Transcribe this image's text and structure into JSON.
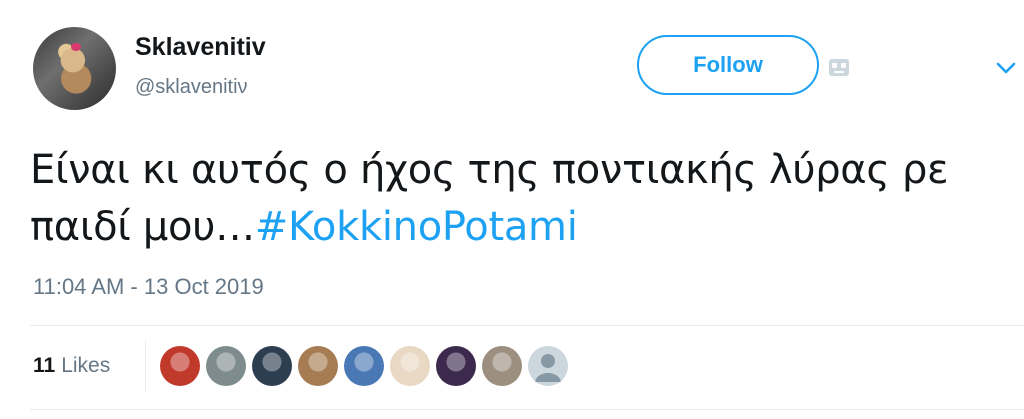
{
  "user": {
    "name": "Sklavenitiv",
    "handle": "@sklavenitiν",
    "avatar_icon": "user-avatar-dog-photo"
  },
  "follow": {
    "label": "Follow",
    "color": "#1da1f2"
  },
  "icons": {
    "bot": "bot-icon",
    "more": "chevron-down-icon"
  },
  "tweet": {
    "text": "Είναι κι αυτός ο ήχος της ποντιακής λύρας ρε παιδί μου…",
    "hashtag": "#KokkinoPotami"
  },
  "timestamp": "11:04 AM - 13 Oct 2019",
  "likes": {
    "count": "11",
    "label": "Likes"
  },
  "likers": [
    {
      "icon": "liker-avatar-red-abstract",
      "bg": "#c0392b"
    },
    {
      "icon": "liker-avatar-person-standing",
      "bg": "#7f8c8d"
    },
    {
      "icon": "liker-avatar-night-scene",
      "bg": "#2c3e50"
    },
    {
      "icon": "liker-avatar-face",
      "bg": "#a67c52"
    },
    {
      "icon": "liker-avatar-sea-landscape",
      "bg": "#4a78b5"
    },
    {
      "icon": "liker-avatar-cat",
      "bg": "#e8d8c4"
    },
    {
      "icon": "liker-avatar-woman-sunglasses",
      "bg": "#3b2a4d"
    },
    {
      "icon": "liker-avatar-cat-gray",
      "bg": "#9c8f80"
    },
    {
      "icon": "default-avatar-icon",
      "bg": "#ccd6dd"
    }
  ]
}
